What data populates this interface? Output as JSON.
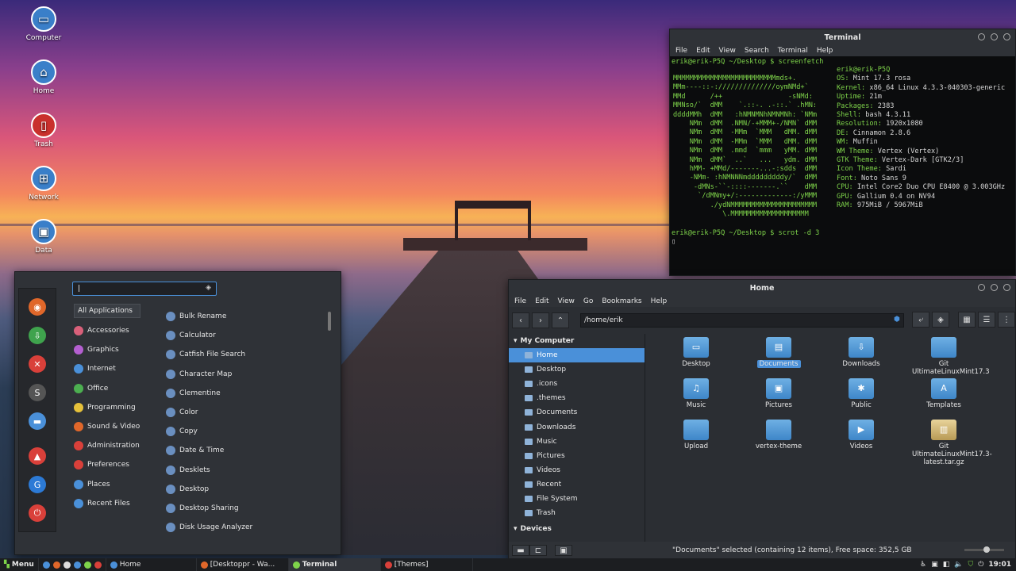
{
  "desktop": {
    "icons": [
      {
        "label": "Computer",
        "icon": "computer-icon",
        "color": "#3a7fc9"
      },
      {
        "label": "Home",
        "icon": "home-icon",
        "color": "#3a7fc9"
      },
      {
        "label": "Trash",
        "icon": "trash-icon",
        "color": "#c9302c"
      },
      {
        "label": "Network",
        "icon": "network-icon",
        "color": "#3a7fc9"
      },
      {
        "label": "Data",
        "icon": "drive-icon",
        "color": "#3a7fc9"
      }
    ]
  },
  "terminal": {
    "title": "Terminal",
    "menu": [
      "File",
      "Edit",
      "View",
      "Search",
      "Terminal",
      "Help"
    ],
    "prompt1": "erik@erik-P5Q ~/Desktop $ screenfetch",
    "prompt2": "erik@erik-P5Q ~/Desktop $ scrot -d 3",
    "cursor": "▯",
    "ascii": [
      "MMMMMMMMMMMMMMMMMMMMMMMMMmds+.",
      "MMm----::-://////////////oymNMd+`",
      "MMd      /++                -sNMd:",
      "MMNso/`  dMM    `.::-. .-::.` .hMN:",
      "ddddMMh  dMM   :hNMNMNhNMNMNh: `NMm",
      "    NMm  dMM  .NMN/-+MMM+-/NMN` dMM",
      "    NMm  dMM  -MMm  `MMM   dMM. dMM",
      "    NMm  dMM  -MMm  `MMM   dMM. dMM",
      "    NMm  dMM  .mmd  `mmm   yMM. dMM",
      "    NMm  dMM`  ..`   ...   ydm. dMM",
      "    hMM- +MMd/-------...-:sdds  dMM",
      "    -NMm- :hNMNNNmdddddddddy/`  dMM",
      "     -dMNs-``-::::-------.``    dMM",
      "      `/dMNmy+/:-------------:/yMMM",
      "         ./ydNMMMMMMMMMMMMMMMMMMMMM",
      "            \\.MMMMMMMMMMMMMMMMMMM"
    ],
    "info": [
      {
        "k": "erik@erik-P5Q",
        "v": ""
      },
      {
        "k": "OS:",
        "v": " Mint 17.3 rosa"
      },
      {
        "k": "Kernel:",
        "v": " x86_64 Linux 4.3.3-040303-generic"
      },
      {
        "k": "Uptime:",
        "v": " 21m"
      },
      {
        "k": "Packages:",
        "v": " 2383"
      },
      {
        "k": "Shell:",
        "v": " bash 4.3.11"
      },
      {
        "k": "Resolution:",
        "v": " 1920x1080"
      },
      {
        "k": "DE:",
        "v": " Cinnamon 2.8.6"
      },
      {
        "k": "WM:",
        "v": " Muffin"
      },
      {
        "k": "WM Theme:",
        "v": " Vertex (Vertex)"
      },
      {
        "k": "GTK Theme:",
        "v": " Vertex-Dark [GTK2/3]"
      },
      {
        "k": "Icon Theme:",
        "v": " Sardi"
      },
      {
        "k": "Font:",
        "v": " Noto Sans 9"
      },
      {
        "k": "CPU:",
        "v": " Intel Core2 Duo CPU E8400 @ 3.003GHz"
      },
      {
        "k": "GPU:",
        "v": " Gallium 0.4 on NV94"
      },
      {
        "k": "RAM:",
        "v": " 975MiB / 5967MiB"
      }
    ]
  },
  "menu": {
    "search_value": "|",
    "favorites": [
      {
        "icon": "firefox-icon",
        "color": "#e0672a"
      },
      {
        "icon": "download-icon",
        "color": "#3fa34d"
      },
      {
        "icon": "tools-icon",
        "color": "#d9403a"
      },
      {
        "icon": "synaptic-icon",
        "color": "#555"
      },
      {
        "icon": "folder-icon",
        "color": "#4a90d9"
      },
      {
        "icon": "lock-icon",
        "color": "#d9403a"
      },
      {
        "icon": "logout-icon",
        "color": "#2c7ad6"
      },
      {
        "icon": "power-icon",
        "color": "#d9403a"
      }
    ],
    "categories": [
      {
        "label": "All Applications",
        "color": "#888"
      },
      {
        "label": "Accessories",
        "color": "#d9607a"
      },
      {
        "label": "Graphics",
        "color": "#b45fd0"
      },
      {
        "label": "Internet",
        "color": "#4a90d9"
      },
      {
        "label": "Office",
        "color": "#4caf50"
      },
      {
        "label": "Programming",
        "color": "#e6c13a"
      },
      {
        "label": "Sound & Video",
        "color": "#e0672a"
      },
      {
        "label": "Administration",
        "color": "#d9403a"
      },
      {
        "label": "Preferences",
        "color": "#d9403a"
      },
      {
        "label": "Places",
        "color": "#4a90d9"
      },
      {
        "label": "Recent Files",
        "color": "#4a90d9"
      }
    ],
    "apps": [
      "Bulk Rename",
      "Calculator",
      "Catfish File Search",
      "Character Map",
      "Clementine",
      "Color",
      "Copy",
      "Date & Time",
      "Desklets",
      "Desktop",
      "Desktop Sharing",
      "Disk Usage Analyzer"
    ]
  },
  "files": {
    "title": "Home",
    "menu": [
      "File",
      "Edit",
      "View",
      "Go",
      "Bookmarks",
      "Help"
    ],
    "path": "/home/erik",
    "section": "My Computer",
    "places": [
      "Home",
      "Desktop",
      ".icons",
      ".themes",
      "Documents",
      "Downloads",
      "Music",
      "Pictures",
      "Videos",
      "Recent",
      "File System",
      "Trash"
    ],
    "devices_label": "Devices",
    "items": [
      {
        "label": "Desktop",
        "glyph": "▭"
      },
      {
        "label": "Documents",
        "glyph": "▤",
        "selected": true
      },
      {
        "label": "Downloads",
        "glyph": "⇩"
      },
      {
        "label": "Git UltimateLinuxMint17.3",
        "glyph": ""
      },
      {
        "label": "Music",
        "glyph": "♫"
      },
      {
        "label": "Pictures",
        "glyph": "▣"
      },
      {
        "label": "Public",
        "glyph": "✱"
      },
      {
        "label": "Templates",
        "glyph": "A"
      },
      {
        "label": "Upload",
        "glyph": ""
      },
      {
        "label": "vertex-theme",
        "glyph": ""
      },
      {
        "label": "Videos",
        "glyph": "▶"
      },
      {
        "label": "Git UltimateLinuxMint17.3-latest.tar.gz",
        "glyph": "▥"
      }
    ],
    "status": "\"Documents\" selected (containing 12 items), Free space: 352,5 GB"
  },
  "panel": {
    "menu_label": "Menu",
    "tasks": [
      "Home",
      "[Desktoppr - Wa...",
      "Terminal",
      "[Themes]"
    ],
    "clock": "19:01"
  }
}
